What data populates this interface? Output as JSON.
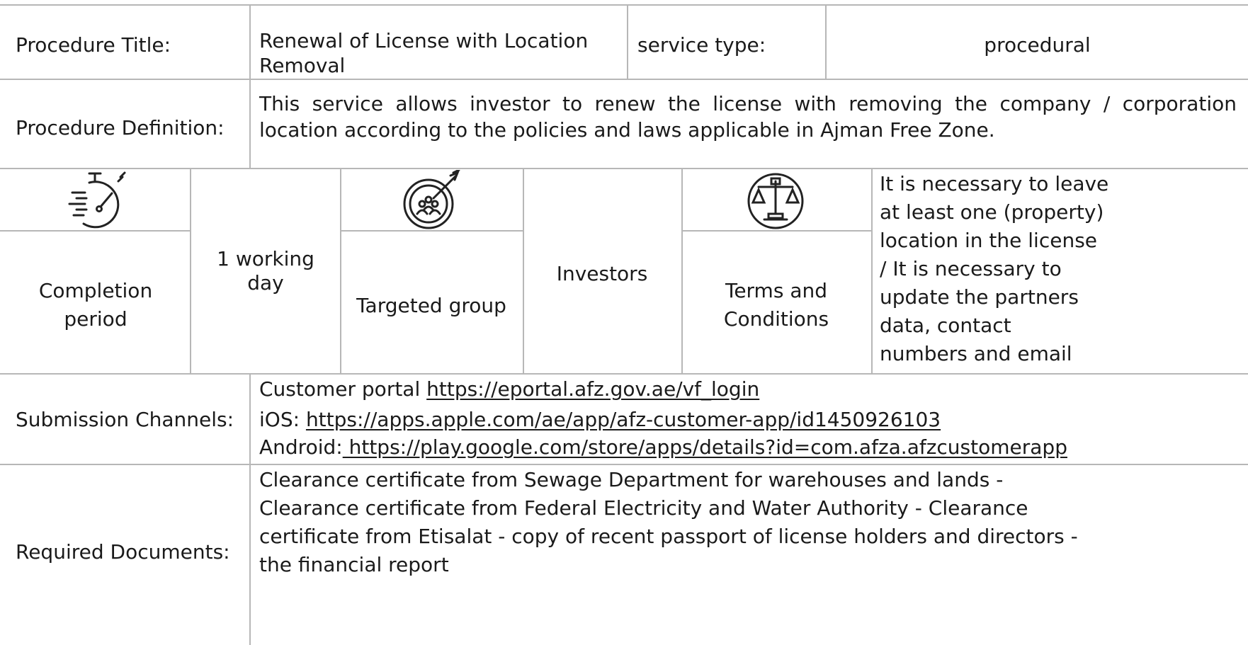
{
  "procedure_title_label": "Procedure Title:",
  "procedure_title_value_line1": "Renewal of License with Location",
  "procedure_title_value_line2": "Removal",
  "service_type_label": "service type:",
  "service_type_value": "procedural",
  "procedure_definition_label": "Procedure Definition:",
  "procedure_definition_value": "This service allows investor to renew the license with removing the company / corporation location according to the policies and laws applicable in Ajman Free Zone.",
  "completion_period": {
    "icon": "stopwatch-icon",
    "label_line1": "Completion",
    "label_line2": "period",
    "value_line1": "1 working",
    "value_line2": "day"
  },
  "targeted_group": {
    "icon": "target-group-icon",
    "label": "Targeted group",
    "value": "Investors"
  },
  "terms_and_conditions": {
    "icon": "scales-icon",
    "label_line1": "Terms and",
    "label_line2": "Conditions",
    "lines": [
      "It is necessary to leave",
      "at least one (property)",
      "location in the license",
      "/ It is necessary to",
      "update the partners",
      "data, contact",
      "numbers and email"
    ]
  },
  "submission_channels": {
    "label": "Submission Channels:",
    "customer_portal_prefix": "Customer portal ",
    "customer_portal_link": "https://eportal.afz.gov.ae/vf_login",
    "ios_prefix": "iOS: ",
    "ios_link": "https://apps.apple.com/ae/app/afz-customer-app/id1450926103",
    "android_prefix": "Android:",
    "android_link": " https://play.google.com/store/apps/details?id=com.afza.afzcustomerapp"
  },
  "required_documents": {
    "label": "Required Documents:",
    "lines": [
      "Clearance certificate from Sewage Department for warehouses and lands -",
      "Clearance certificate from Federal Electricity and Water Authority - Clearance",
      "certificate from Etisalat - copy of recent passport of license holders and directors -",
      "the financial report"
    ]
  }
}
